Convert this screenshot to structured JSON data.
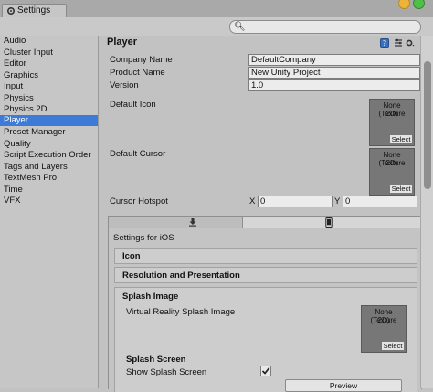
{
  "window": {
    "tab_title": "Settings"
  },
  "search": {
    "placeholder": ""
  },
  "sidebar": {
    "items": [
      {
        "label": "Audio"
      },
      {
        "label": "Cluster Input"
      },
      {
        "label": "Editor"
      },
      {
        "label": "Graphics"
      },
      {
        "label": "Input"
      },
      {
        "label": "Physics"
      },
      {
        "label": "Physics 2D"
      },
      {
        "label": "Player"
      },
      {
        "label": "Preset Manager"
      },
      {
        "label": "Quality"
      },
      {
        "label": "Script Execution Order"
      },
      {
        "label": "Tags and Layers"
      },
      {
        "label": "TextMesh Pro"
      },
      {
        "label": "Time"
      },
      {
        "label": "VFX"
      }
    ],
    "selected": "Player"
  },
  "main": {
    "title": "Player",
    "company_label": "Company Name",
    "company_value": "DefaultCompany",
    "product_label": "Product Name",
    "product_value": "New Unity Project",
    "version_label": "Version",
    "version_value": "1.0",
    "icon_label": "Default Icon",
    "cursor_label": "Default Cursor",
    "texture_line1": "None (Texture",
    "texture_line2": "2D)",
    "select_label": "Select",
    "hotspot_label": "Cursor Hotspot",
    "hotspot_x_label": "X",
    "hotspot_x_value": "0",
    "hotspot_y_label": "Y",
    "hotspot_y_value": "0"
  },
  "platform": {
    "settings_title": "Settings for iOS",
    "sections": {
      "icon": "Icon",
      "resolution": "Resolution and Presentation",
      "splash": "Splash Image"
    },
    "vr_splash_label": "Virtual Reality Splash Image",
    "splash_screen_heading": "Splash Screen",
    "show_splash_label": "Show Splash Screen",
    "show_splash_checked": true,
    "preview_label": "Preview"
  },
  "colors": {
    "selection": "#3d7bd6",
    "panel": "#c2c2c2"
  }
}
